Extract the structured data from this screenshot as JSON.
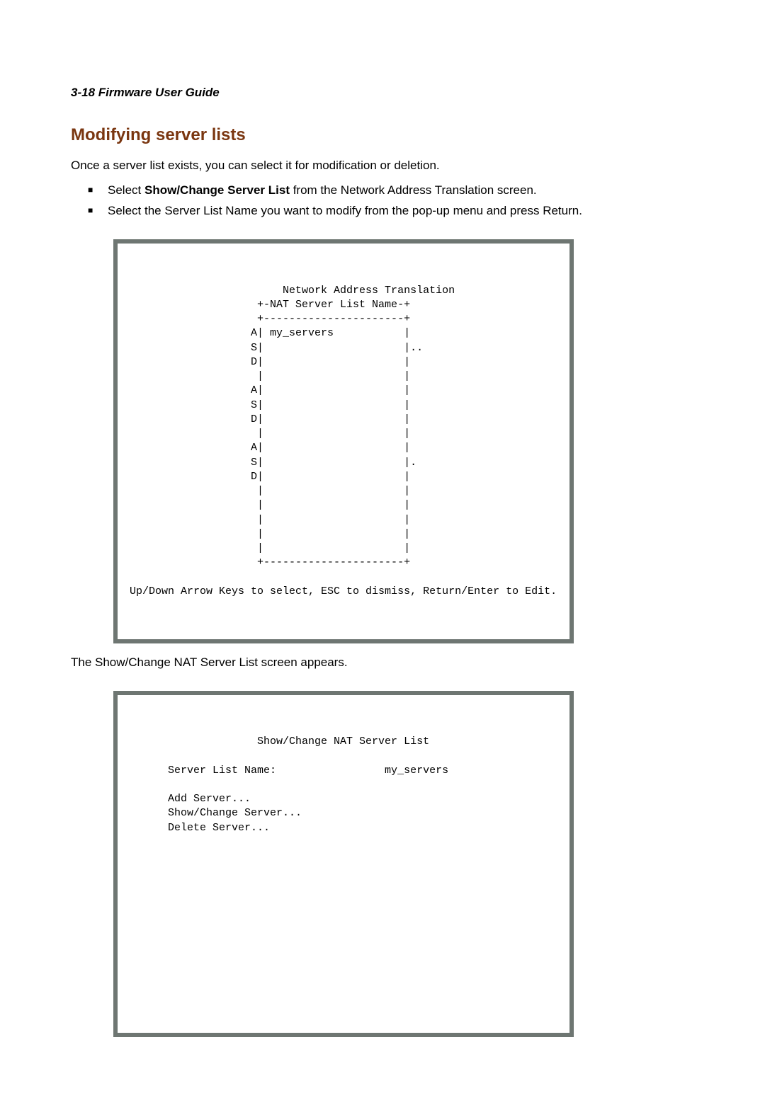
{
  "runningHead": "3-18  Firmware User Guide",
  "sectionHead": "Modifying server lists",
  "intro": "Once a server list exists, you can select it for modification or deletion.",
  "bullets": [
    {
      "prefix": "Select ",
      "bold": "Show/Change Server List",
      "suffix": " from the Network Address Translation screen."
    },
    {
      "prefix": "Select the Server List Name you want to modify from the pop-up menu and press Return.",
      "bold": "",
      "suffix": ""
    }
  ],
  "terminal1": "                         Network Address Translation\n                     +-NAT Server List Name-+\n                     +----------------------+\n                    A| my_servers           |\n                    S|                      |..\n                    D|                      |\n                     |                      |\n                    A|                      |\n                    S|                      |\n                    D|                      |\n                     |                      |\n                    A|                      |\n                    S|                      |.\n                    D|                      |\n                     |                      |\n                     |                      |\n                     |                      |\n                     |                      |\n                     |                      |\n                     +----------------------+\n\n Up/Down Arrow Keys to select, ESC to dismiss, Return/Enter to Edit.",
  "between": "The Show/Change NAT Server List screen appears.",
  "terminal2": "                     Show/Change NAT Server List\n\n       Server List Name:                 my_servers\n\n       Add Server...\n       Show/Change Server...\n       Delete Server...\n\n\n\n\n\n\n\n\n\n\n\n"
}
